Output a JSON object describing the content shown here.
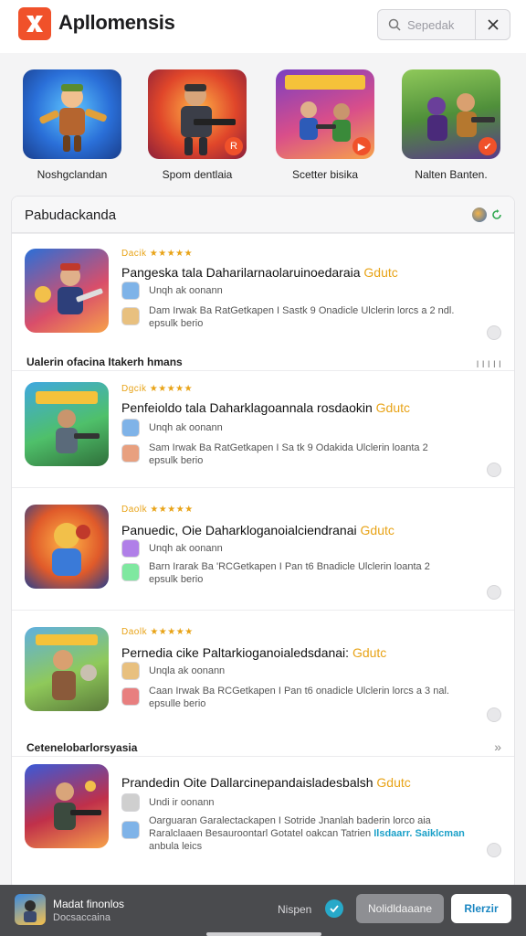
{
  "header": {
    "app_title": "Apllomensis",
    "search_placeholder": "Sepedak"
  },
  "featured": [
    {
      "label": "Noshgclandan",
      "badge": ""
    },
    {
      "label": "Spom dentlaia",
      "badge": "R"
    },
    {
      "label": "Scetter bisika",
      "badge": "▶"
    },
    {
      "label": "Nalten Banten.",
      "badge": "✔"
    }
  ],
  "panel": {
    "title": "Pabudackanda",
    "section2": "Ualerin ofacina Itakerh hmans",
    "section2_meta": "I I I I I",
    "section3": "Cetenelobarlorsyasia",
    "cards": [
      {
        "rating": "Dacik ★★★★★",
        "title": "Pangeska tala Daharilarnaolaruinoedaraia",
        "title_accent": "Gdutc",
        "sub": "Unqh ak oonann",
        "desc1": "Dam Irwak Ba  RatGetkapen I  Sastk 9 Onadicle Ulclerin lorcs a 2 ndl.",
        "desc2": "epsulk berio",
        "link": ""
      },
      {
        "rating": "Dgcik ★★★★★",
        "title": "Penfeioldo tala Daharklagoannala rosdaokin",
        "title_accent": "Gdutc",
        "sub": "Unqh ak oonann",
        "desc1": "Sam Irwak Ba  RatGetkapen I Sa tk 9 Odakida Ulclerin loanta 2",
        "desc2": "epsulk berio",
        "link": ""
      },
      {
        "rating": "Daolk ★★★★★",
        "title": "Panuedic, Oie Daharkloganoialciendranai",
        "title_accent": "Gdutc",
        "sub": "Unqh ak oonann",
        "desc1": "Barn Irarak Ba  'RCGetkapen I  Pan t6 Bnadicle Ulclerin loanta 2",
        "desc2": "epsulk berio",
        "link": ""
      },
      {
        "rating": "Daolk ★★★★★",
        "title": "Pernedia cike Paltarkioganoialedsdanai:",
        "title_accent": "Gdutc",
        "sub": "Unqla ak oonann",
        "desc1": "Caan Irwak Ba  RCGetkapen I  Pan t6 onadicle Ulclerin lorcs a 3 nal.",
        "desc2": "epsulle berio",
        "link": ""
      },
      {
        "rating": "",
        "title": "Prandedin Oite Dallarcinepandaisladesbalsh",
        "title_accent": "Gdutc",
        "sub": "Undi ir oonann",
        "desc1": "Oarguaran Garalectackapen I  Sotride Jnanlah baderin lorco aia",
        "desc2": "Raralclaaen Besauroontarl Gotatel oakcan Tatrien",
        "desc3": "anbula leics",
        "link": "Ilsdaarr. Saiklcman"
      }
    ]
  },
  "bottom_bar": {
    "title": "Madat finonlos",
    "sub": "Docsaccaina",
    "status": "Nispen",
    "secondary_label": "Nolidldaaane",
    "primary_label": "Rlerzir"
  },
  "colors": {
    "accent": "#f0512a",
    "rating": "#e8a317",
    "link": "#1aa0c8",
    "bottom_bar": "#4a4b4e"
  }
}
